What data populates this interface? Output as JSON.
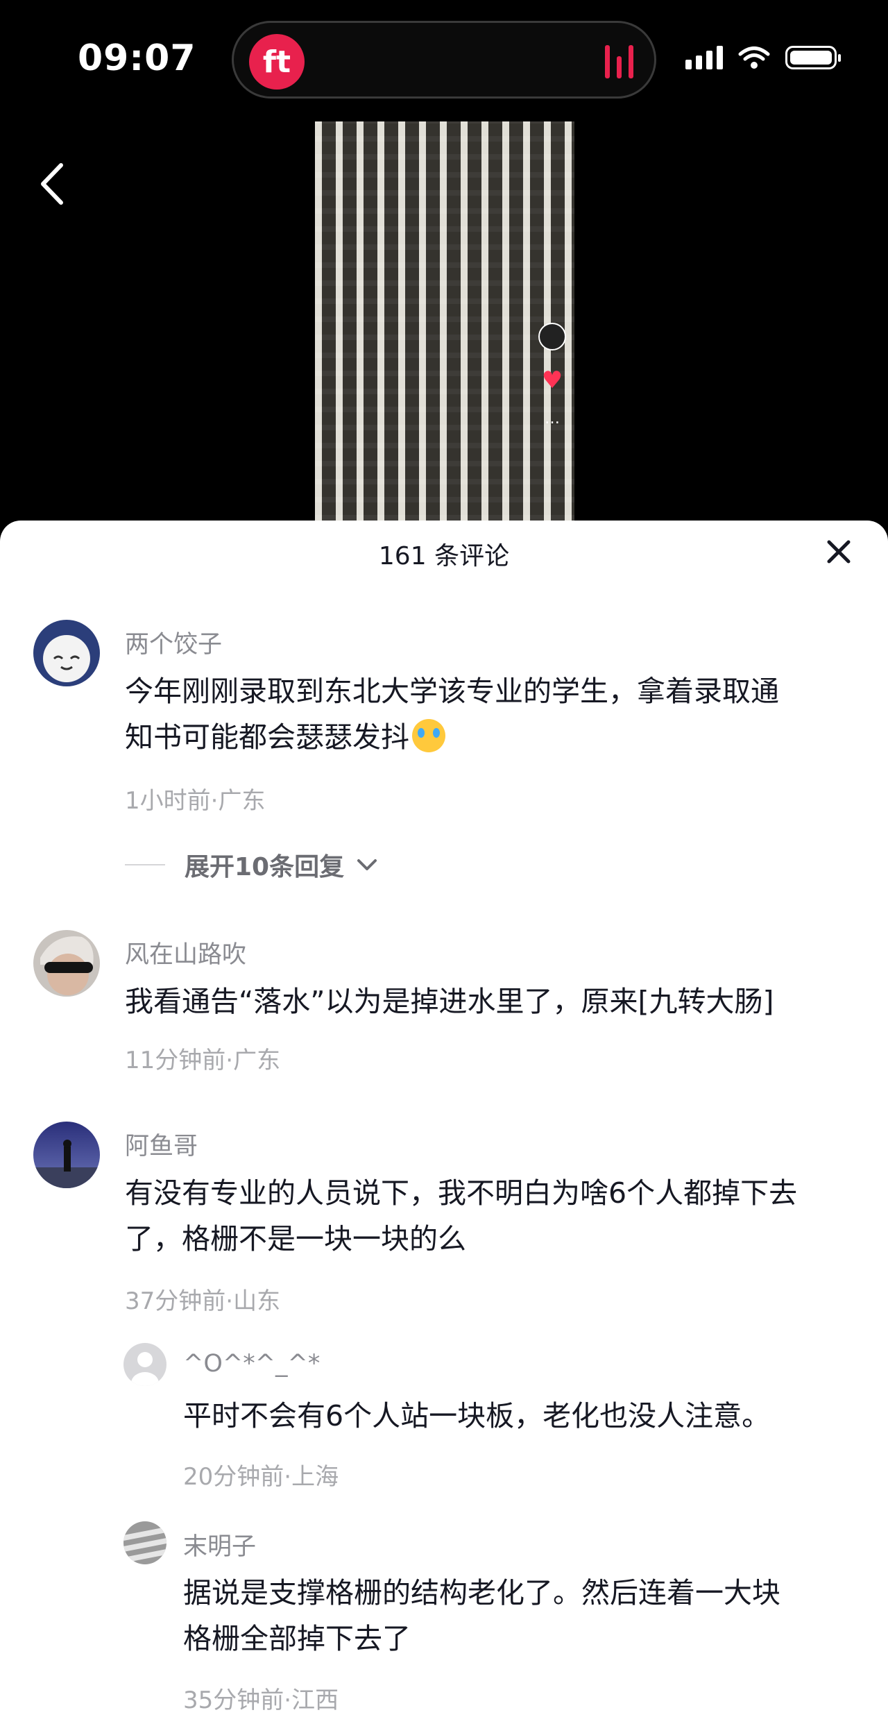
{
  "status_bar": {
    "time": "09:07",
    "app_badge": "ft"
  },
  "comments_header": {
    "title": "161 条评论"
  },
  "comments": [
    {
      "user": "两个饺子",
      "text_line1": "今年刚刚录取到东北大学该专业的学生，拿着录取通",
      "text_line2": "知书可能都会瑟瑟发抖",
      "emoji": "crying-face-icon",
      "meta": "1小时前·广东",
      "expand_label": "展开10条回复"
    },
    {
      "user": "风在山路吹",
      "text_line1": "我看通告“落水”以为是掉进水里了，原来[九转大肠]",
      "meta": "11分钟前·广东"
    },
    {
      "user": "阿鱼哥",
      "text_line1": "有没有专业的人员说下，我不明白为啥6个人都掉下去",
      "text_line2": "了，格栅不是一块一块的么",
      "meta": "37分钟前·山东"
    }
  ],
  "replies": [
    {
      "user": "^O^*^_^*",
      "text_line1": "平时不会有6个人站一块板，老化也没人注意。",
      "meta": "20分钟前·上海"
    },
    {
      "user": "末明子",
      "text_line1": "据说是支撑格栅的结构老化了。然后连着一大块",
      "text_line2": "格栅全部掉下去了",
      "meta": "35分钟前·江西"
    }
  ],
  "colors": {
    "accent": "#e8214d",
    "text_primary": "#161823",
    "text_secondary": "#8a8b91"
  }
}
